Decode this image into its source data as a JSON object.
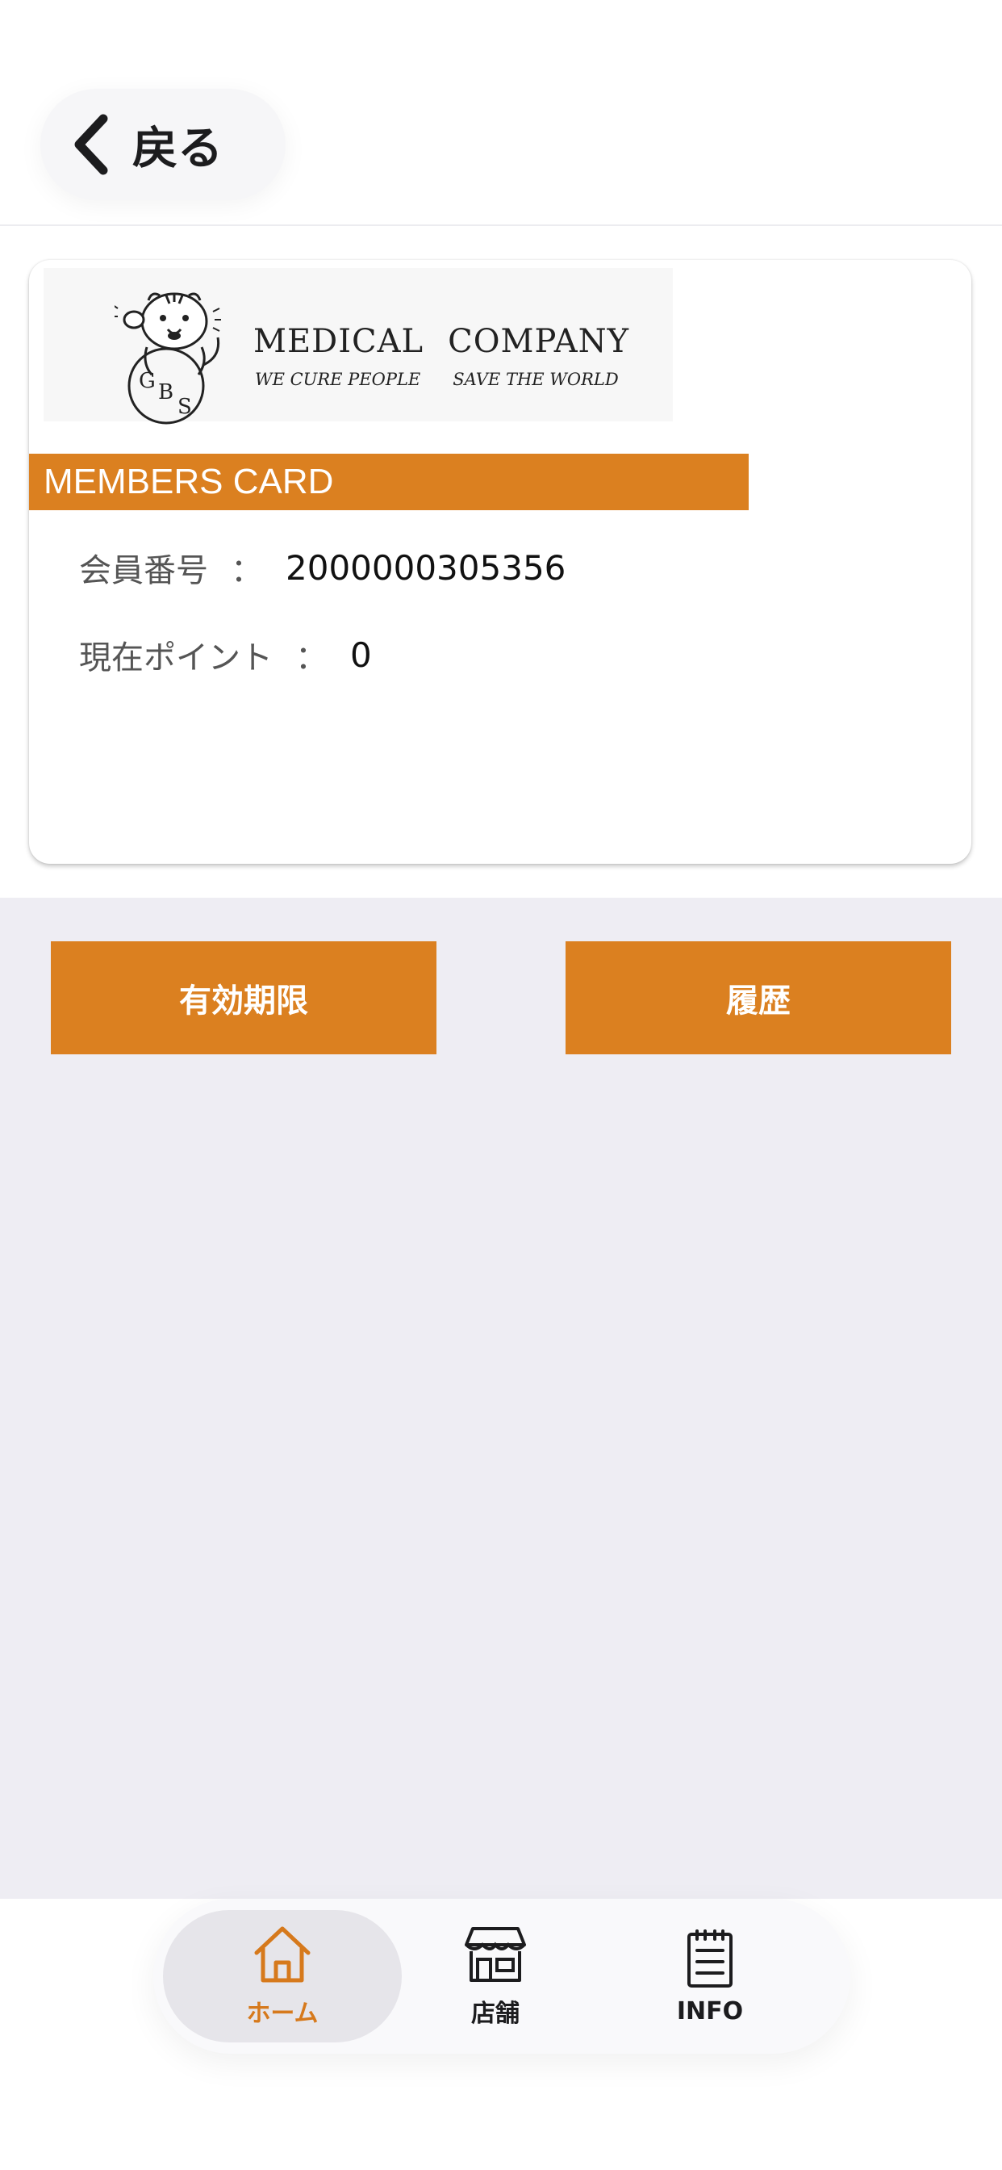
{
  "header": {
    "back_label": "戻る",
    "back_icon": "chevron-left-icon"
  },
  "card": {
    "logo": {
      "company_word1": "MEDICAL",
      "company_word2": "COMPANY",
      "slogan_part1": "WE CURE PEOPLE",
      "slogan_part2": "SAVE THE WORLD",
      "emblem_text": "GBS"
    },
    "banner_label": "MEMBERS CARD",
    "fields": {
      "member_number_label": "会員番号",
      "member_number_value": "2000000305356",
      "points_label": "現在ポイント",
      "points_value": "0",
      "separator": "："
    }
  },
  "actions": {
    "expiry_label": "有効期限",
    "history_label": "履歴"
  },
  "tabbar": {
    "items": [
      {
        "label": "ホーム",
        "icon": "home-icon",
        "active": true
      },
      {
        "label": "店舗",
        "icon": "store-icon",
        "active": false
      },
      {
        "label": "INFO",
        "icon": "notepad-icon",
        "active": false
      }
    ]
  },
  "colors": {
    "accent": "#db8020",
    "background_gray": "#eeedf3",
    "active_tab_text": "#d6791c"
  }
}
